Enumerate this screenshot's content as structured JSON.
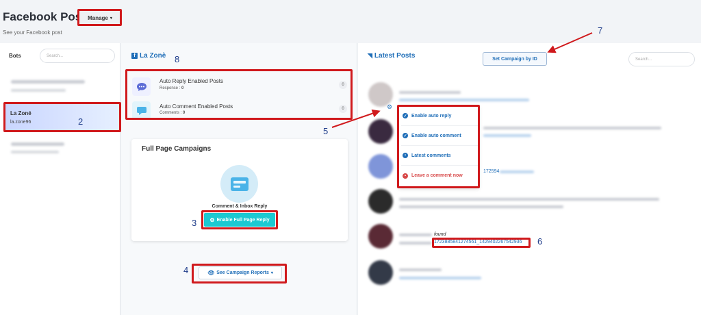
{
  "header": {
    "title": "Facebook Post List",
    "subtitle": "See your Facebook post",
    "manage_label": "Manage"
  },
  "bots": {
    "label": "Bots",
    "search_placeholder": "Search...",
    "active": {
      "name": "La Zoné",
      "handle": "la.zone96"
    }
  },
  "page": {
    "name": "La Zonè",
    "auto_reply": {
      "title": "Auto Reply Enabled Posts",
      "sub_label": "Response :",
      "value": "0",
      "count": "0"
    },
    "auto_comment": {
      "title": "Auto Comment Enabled Posts",
      "sub_label": "Comments :",
      "value": "0",
      "count": "0"
    },
    "campaigns": {
      "title": "Full Page Campaigns",
      "label": "Comment & Inbox Reply",
      "enable_label": "Enable Full Page Reply"
    },
    "reports_label": "See Campaign Reports"
  },
  "latest": {
    "title": "Latest Posts",
    "set_campaign_label": "Set Campaign by ID",
    "search_placeholder": "Search...",
    "menu": [
      {
        "label": "Enable auto reply"
      },
      {
        "label": "Enable auto comment"
      },
      {
        "label": "Latest comments"
      },
      {
        "label": "Leave a comment now"
      }
    ],
    "partial_id": "172594",
    "found_label": "found",
    "post_id": "1723885841274561_1429402267542936"
  },
  "annotations": [
    "2",
    "3",
    "4",
    "5",
    "6",
    "7",
    "8"
  ],
  "colors": {
    "annotation_box": "#d0191c",
    "accent": "#1f6eb8",
    "enable_button": "#1bc9d2",
    "danger": "#d84a4a"
  }
}
